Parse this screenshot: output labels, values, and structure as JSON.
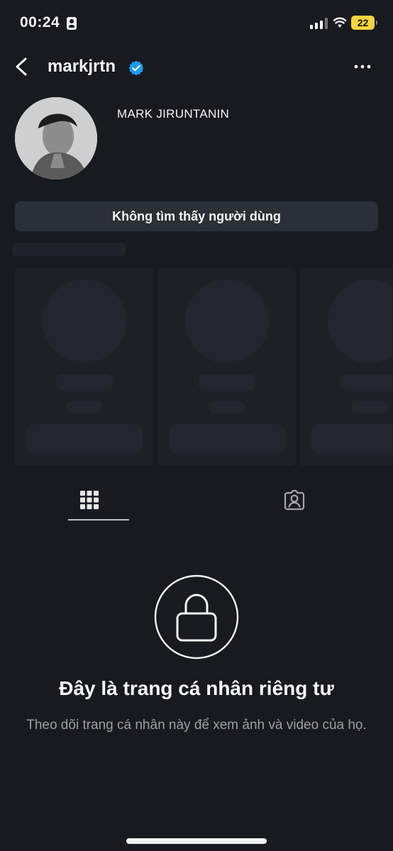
{
  "status_bar": {
    "time": "00:24",
    "battery": "22"
  },
  "header": {
    "username": "markjrtn"
  },
  "profile": {
    "display_name": "MARK JIRUNTANIN",
    "not_found_label": "Không tìm thấy người dùng"
  },
  "private": {
    "title": "Đây là trang cá nhân riêng tư",
    "subtitle": "Theo dõi trang cá nhân này để xem ảnh và video của họ."
  },
  "colors": {
    "background": "#171a1f",
    "verified": "#1d9bf0",
    "battery": "#f4d43b"
  },
  "icons": {
    "back": "chevron-left-icon",
    "verified": "verified-badge-icon",
    "more": "more-options-icon",
    "grid": "grid-icon",
    "tagged": "tagged-person-icon",
    "lock": "lock-icon"
  }
}
